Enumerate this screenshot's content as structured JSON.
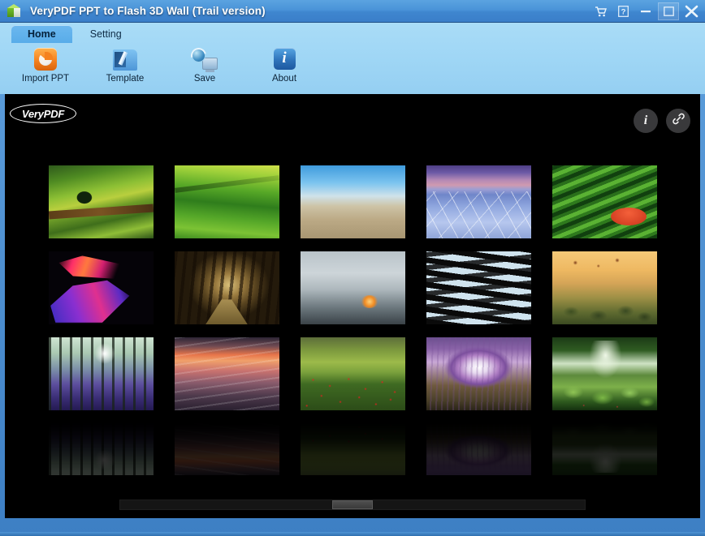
{
  "window": {
    "title": "VeryPDF PPT to Flash 3D Wall (Trail version)",
    "app_icon": "cube-icon",
    "controls": [
      {
        "name": "cart-icon",
        "glyph": "cart"
      },
      {
        "name": "help-icon",
        "glyph": "help"
      },
      {
        "name": "minimize-icon",
        "glyph": "minimize"
      },
      {
        "name": "maximize-icon",
        "glyph": "maximize"
      },
      {
        "name": "close-icon",
        "glyph": "close"
      }
    ]
  },
  "ribbon": {
    "tabs": [
      {
        "label": "Home",
        "active": true
      },
      {
        "label": "Setting",
        "active": false
      }
    ],
    "buttons": [
      {
        "label": "Import PPT",
        "icon": "import-ppt-icon"
      },
      {
        "label": "Template",
        "icon": "template-icon"
      },
      {
        "label": "Save",
        "icon": "save-icon"
      },
      {
        "label": "About",
        "icon": "about-icon"
      }
    ]
  },
  "stage": {
    "logo_text": "VeryPDF",
    "overlay_buttons": [
      {
        "name": "info-button",
        "icon": "info-icon",
        "glyph": "i"
      },
      {
        "name": "link-button",
        "icon": "link-icon",
        "glyph": "link"
      }
    ],
    "scrollbar": {
      "name": "horizontal-scrollbar",
      "thumb_position_percent": 50
    },
    "wall": {
      "columns": 5,
      "rows": 3,
      "reflection_row": true,
      "thumbnails": [
        {
          "id": 1,
          "title": "Lone tree on green rolling field",
          "art": "a-tree"
        },
        {
          "id": 2,
          "title": "Rolling green hills",
          "art": "a-hills"
        },
        {
          "id": 3,
          "title": "Frosted tree over winter grassland",
          "art": "a-frost"
        },
        {
          "id": 4,
          "title": "Cracked salt flats at twilight",
          "art": "a-salt"
        },
        {
          "id": 5,
          "title": "Green tea terraces with red umbrella",
          "art": "a-tea"
        },
        {
          "id": 6,
          "title": "Abstract pink and violet light streaks",
          "art": "a-abstract"
        },
        {
          "id": 7,
          "title": "Sunlit dark hedges forest path",
          "art": "a-hedges"
        },
        {
          "id": 8,
          "title": "Misty water with glowing fire",
          "art": "a-mist"
        },
        {
          "id": 9,
          "title": "Patterned rice terraces from above",
          "art": "a-rice"
        },
        {
          "id": 10,
          "title": "Hot air balloons over Bagan temples",
          "art": "a-bagan"
        },
        {
          "id": 11,
          "title": "Bluebell forest with sunbeams",
          "art": "a-bluebell"
        },
        {
          "id": 12,
          "title": "Sunset clouds over dunes",
          "art": "a-dunes"
        },
        {
          "id": 13,
          "title": "Red poppy field beside vineyard",
          "art": "a-poppy"
        },
        {
          "id": 14,
          "title": "Wisteria flower tunnel",
          "art": "a-wisteria"
        },
        {
          "id": 15,
          "title": "Mossy forest path in green light",
          "art": "a-moss"
        }
      ]
    }
  },
  "colors": {
    "titlebar_blue": "#4a93d8",
    "ribbon_blue": "#9fd6f5",
    "tab_active_blue": "#58ace9",
    "stage_black": "#000000",
    "accent_orange": "#f5821f",
    "scroll_thumb": "#4f4f4f"
  }
}
